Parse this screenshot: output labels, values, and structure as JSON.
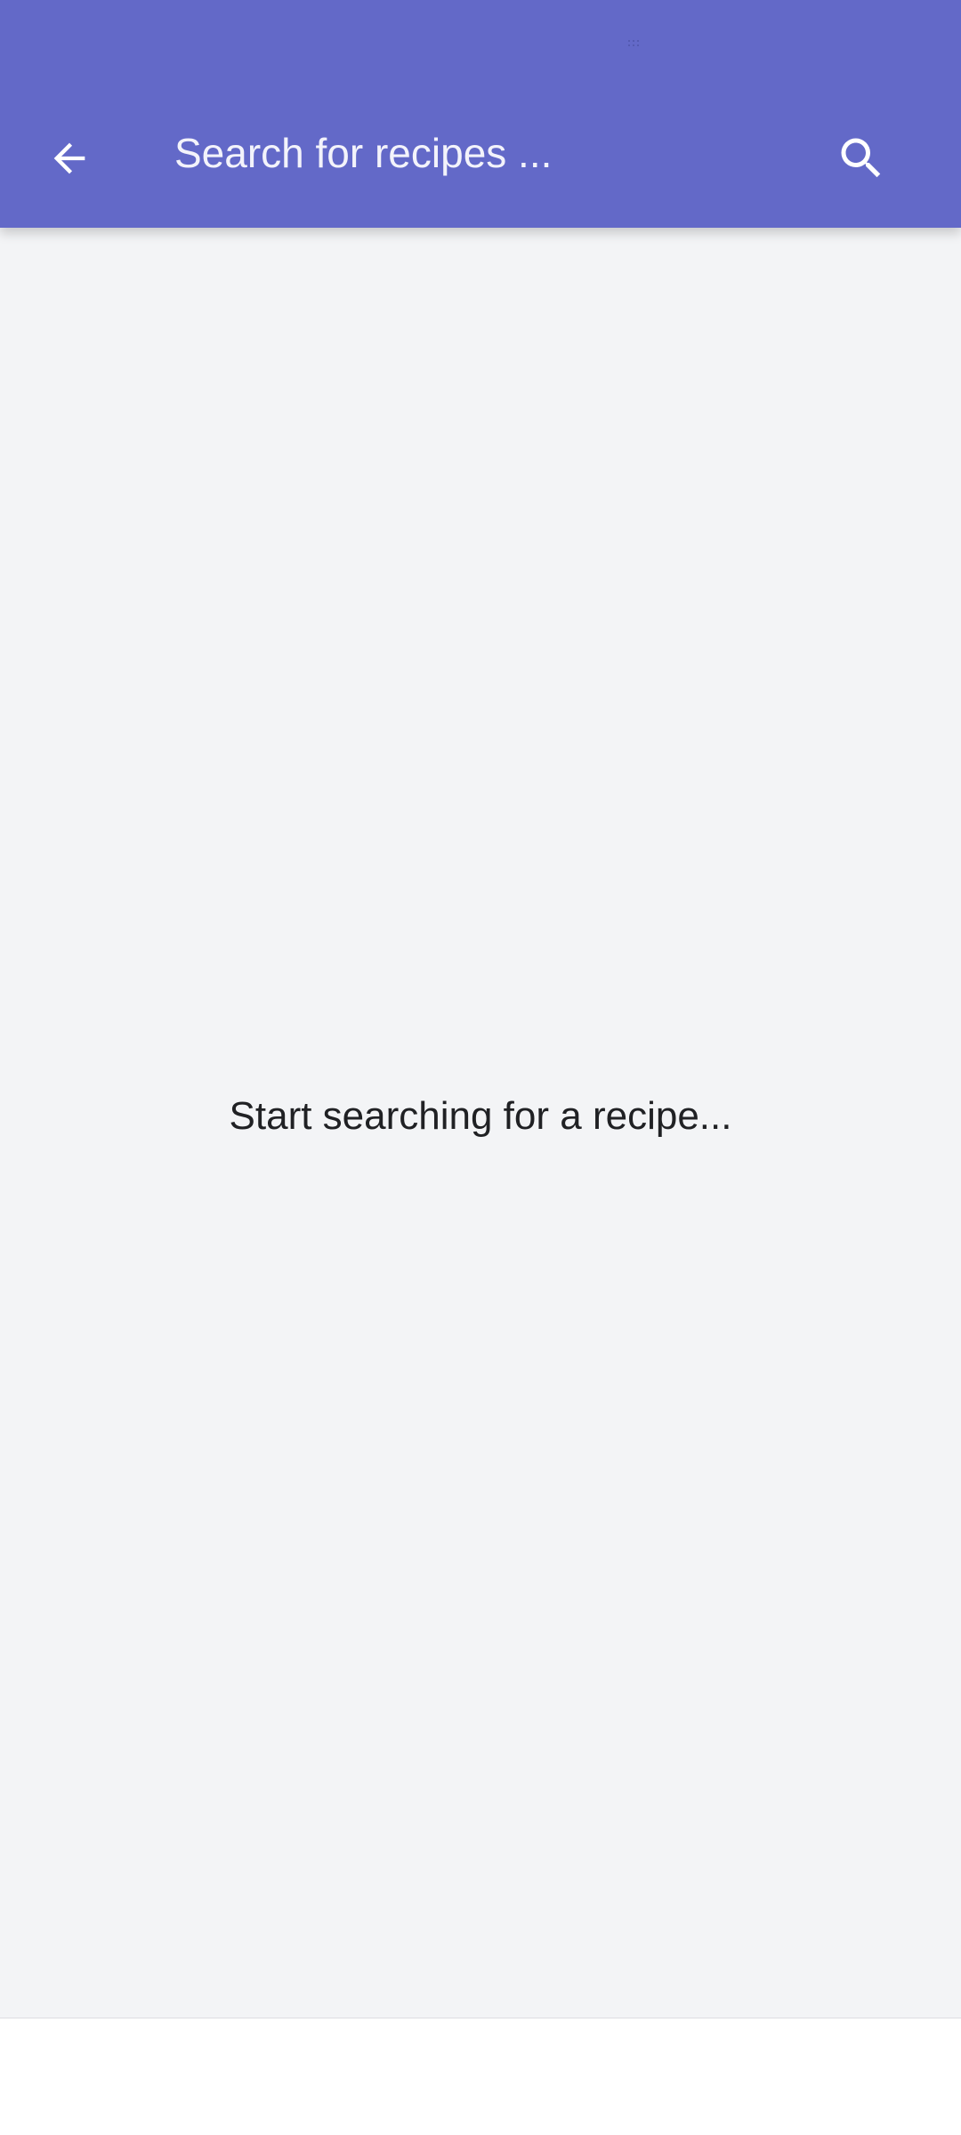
{
  "colors": {
    "app_bar": "#6369C8",
    "content_bg": "#F3F4F6",
    "bottom_bg": "#FFFFFF",
    "icon": "#FFFFFF",
    "message_text": "#202124"
  },
  "app_bar": {
    "back_icon": "arrow-left-icon",
    "search_icon": "search-icon",
    "search_placeholder": "Search for recipes ...",
    "search_value": ""
  },
  "content": {
    "empty_message": "Start searching for a recipe..."
  }
}
